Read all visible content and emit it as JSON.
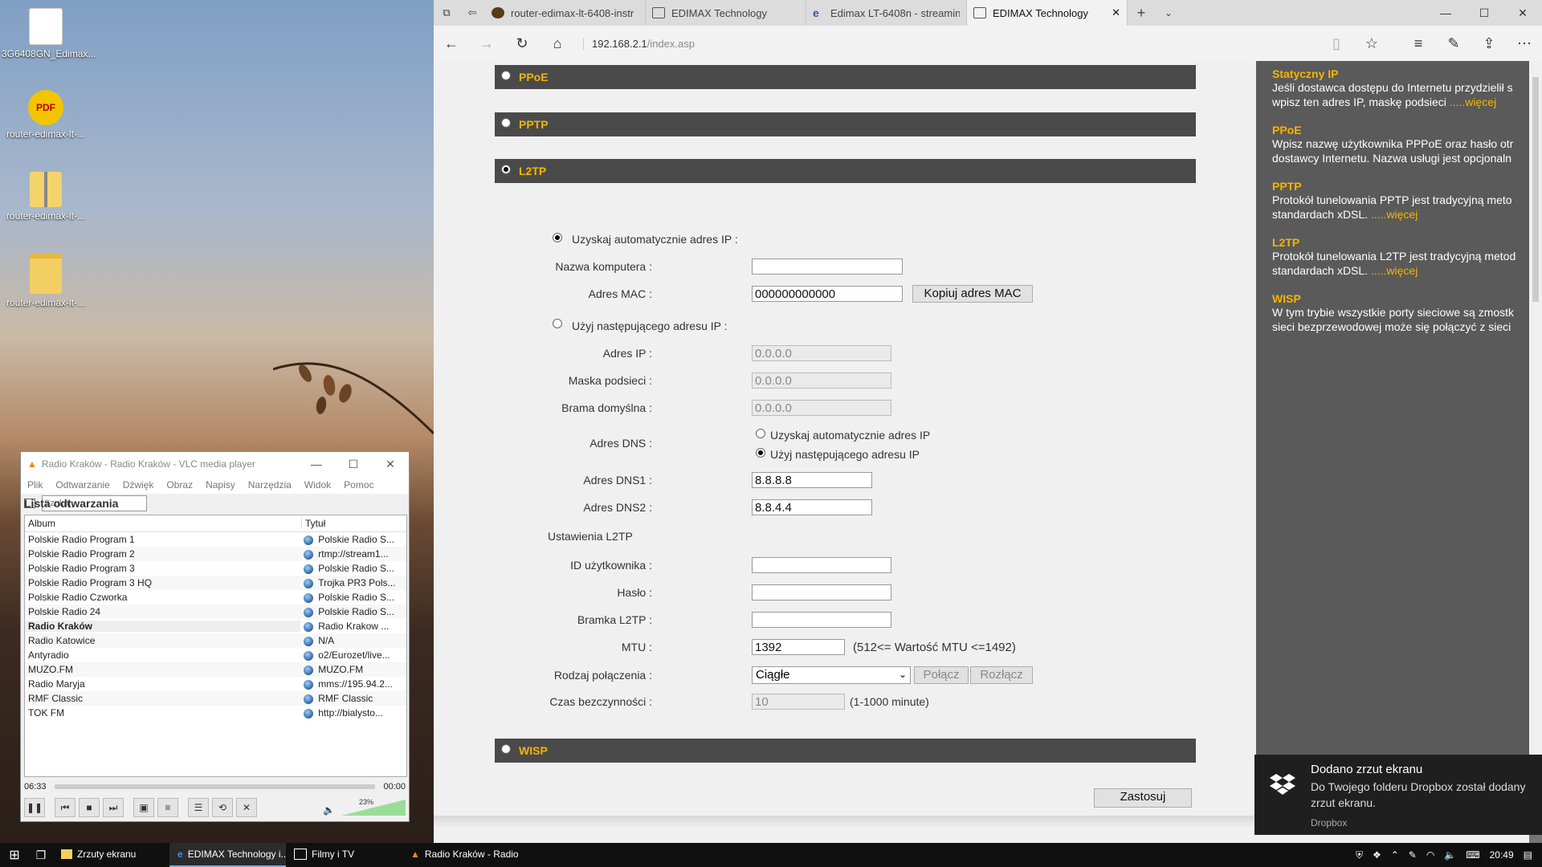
{
  "desktop": {
    "icons": [
      {
        "label": "3G6408GN_Edimax..."
      },
      {
        "label": "router-edimax-lt-..."
      },
      {
        "label": "router-edimax-lt-..."
      },
      {
        "label": "router-edimax-lt-..."
      }
    ]
  },
  "vlc": {
    "title": "Radio Kraków - Radio Kraków - VLC media player",
    "menu": [
      "Plik",
      "Odtwarzanie",
      "Dźwięk",
      "Obraz",
      "Napisy",
      "Narzędzia",
      "Widok",
      "Pomoc"
    ],
    "playlist_label": "Lista odtwarzania",
    "search_placeholder": "Szukaj",
    "col_album": "Album",
    "col_title": "Tytuł",
    "rows": [
      {
        "album": "Polskie Radio Program 1",
        "title": "Polskie Radio S..."
      },
      {
        "album": "Polskie Radio Program 2",
        "title": "rtmp://stream1..."
      },
      {
        "album": "Polskie Radio Program 3",
        "title": "Polskie Radio S..."
      },
      {
        "album": "Polskie Radio Program 3 HQ",
        "title": "Trojka PR3 Pols..."
      },
      {
        "album": "Polskie Radio Czworka",
        "title": "Polskie Radio S..."
      },
      {
        "album": "Polskie Radio 24",
        "title": "Polskie Radio S..."
      },
      {
        "album": "Radio Kraków",
        "title": "Radio Krakow ..."
      },
      {
        "album": "Radio Katowice",
        "title": "N/A"
      },
      {
        "album": "Antyradio",
        "title": "o2/Eurozet/live..."
      },
      {
        "album": "MUZO.FM",
        "title": "MUZO.FM"
      },
      {
        "album": "Radio Maryja",
        "title": "mms://195.94.2..."
      },
      {
        "album": "RMF Classic",
        "title": "RMF Classic"
      },
      {
        "album": "TOK FM",
        "title": "http://bialysto..."
      }
    ],
    "time_elapsed": "06:33",
    "time_total": "00:00",
    "volume": "23%"
  },
  "browser": {
    "tabs": [
      {
        "label": "router-edimax-lt-6408-instr"
      },
      {
        "label": "EDIMAX Technology"
      },
      {
        "label": "Edimax LT-6408n - streamin"
      },
      {
        "label": "EDIMAX Technology"
      }
    ],
    "url_host": "192.168.2.1",
    "url_path": "/index.asp"
  },
  "form": {
    "sections": {
      "pppoe": "PPoE",
      "pptp": "PPTP",
      "l2tp": "L2TP",
      "wisp": "WISP"
    },
    "auto_ip": "Uzyskaj automatycznie adres IP :",
    "hostname_label": "Nazwa komputera :",
    "hostname_value": "",
    "mac_label": "Adres MAC :",
    "mac_value": "000000000000",
    "copy_mac": "Kopiuj adres MAC",
    "static_ip": "Użyj następującego adresu IP :",
    "ip_label": "Adres IP :",
    "ip_value": "0.0.0.0",
    "mask_label": "Maska podsieci :",
    "mask_value": "0.0.0.0",
    "gw_label": "Brama domyślna :",
    "gw_value": "0.0.0.0",
    "dns_label": "Adres DNS :",
    "dns_auto": "Uzyskaj automatycznie adres IP",
    "dns_manual": "Użyj następującego adresu IP",
    "dns1_label": "Adres DNS1 :",
    "dns1_value": "8.8.8.8",
    "dns2_label": "Adres DNS2 :",
    "dns2_value": "8.8.4.4",
    "l2tp_settings": "Ustawienia L2TP",
    "userid_label": "ID użytkownika :",
    "pass_label": "Hasło :",
    "gateway_label": "Bramka L2TP :",
    "mtu_label": "MTU :",
    "mtu_value": "1392",
    "mtu_note": "(512<= Wartość MTU <=1492)",
    "conn_label": "Rodzaj połączenia :",
    "conn_value": "Ciągłe",
    "connect": "Połącz",
    "disconnect": "Rozłącz",
    "idle_label": "Czas bezczynności :",
    "idle_value": "10",
    "idle_note": "(1-1000 minute)",
    "apply": "Zastosuj"
  },
  "help": [
    {
      "title": "Statyczny IP",
      "lines": [
        "Jeśli dostawca dostępu do Internetu przydzielił s",
        "wpisz ten adres IP, maskę podsieci"
      ],
      "more": ".....więcej"
    },
    {
      "title": "PPoE",
      "lines": [
        "Wpisz nazwę użytkownika PPPoE oraz hasło otr",
        "dostawcy Internetu. Nazwa usługi jest opcjonaln"
      ],
      "more": ""
    },
    {
      "title": "PPTP",
      "lines": [
        "Protokół tunelowania PPTP jest tradycyjną meto",
        "standardach xDSL."
      ],
      "more": ".....więcej"
    },
    {
      "title": "L2TP",
      "lines": [
        "Protokół tunelowania L2TP jest tradycyjną metod",
        "standardach xDSL."
      ],
      "more": ".....więcej"
    },
    {
      "title": "WISP",
      "lines": [
        "W tym trybie wszystkie porty sieciowe są zmostk",
        "sieci bezprzewodowej może się połączyć z sieci"
      ],
      "more": ""
    }
  ],
  "toast": {
    "title": "Dodano zrzut ekranu",
    "body": "Do Twojego folderu Dropbox został dodany zrzut ekranu.",
    "source": "Dropbox"
  },
  "taskbar": {
    "items": [
      {
        "label": "Zrzuty ekranu"
      },
      {
        "label": "EDIMAX Technology i..."
      },
      {
        "label": "Filmy i TV"
      },
      {
        "label": "Radio Kraków - Radio..."
      }
    ],
    "clock": "20:49"
  }
}
